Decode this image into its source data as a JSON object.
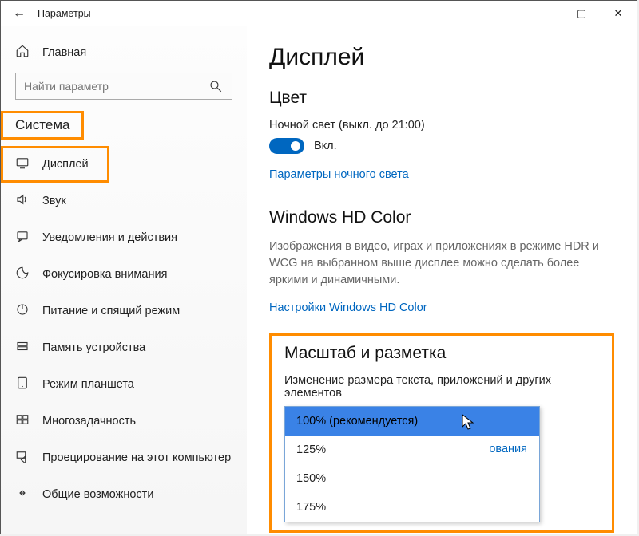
{
  "window": {
    "title": "Параметры"
  },
  "sidebar": {
    "home": "Главная",
    "search_placeholder": "Найти параметр",
    "category": "Система",
    "items": [
      {
        "label": "Дисплей"
      },
      {
        "label": "Звук"
      },
      {
        "label": "Уведомления и действия"
      },
      {
        "label": "Фокусировка внимания"
      },
      {
        "label": "Питание и спящий режим"
      },
      {
        "label": "Память устройства"
      },
      {
        "label": "Режим планшета"
      },
      {
        "label": "Многозадачность"
      },
      {
        "label": "Проецирование на этот компьютер"
      },
      {
        "label": "Общие возможности"
      }
    ]
  },
  "content": {
    "page_title": "Дисплей",
    "color_heading": "Цвет",
    "night_light_label": "Ночной свет (выкл. до 21:00)",
    "toggle_text": "Вкл.",
    "night_light_link": "Параметры ночного света",
    "hd_heading": "Windows HD Color",
    "hd_desc": "Изображения в видео, играх и приложениях в режиме HDR и WCG на выбранном выше дисплее можно сделать более яркими и динамичными.",
    "hd_link": "Настройки Windows HD Color",
    "scale_heading": "Масштаб и разметка",
    "scale_label": "Изменение размера текста, приложений и других элементов",
    "scale_options": [
      "100% (рекомендуется)",
      "125%",
      "150%",
      "175%"
    ],
    "partial_link_tail": "ования"
  }
}
